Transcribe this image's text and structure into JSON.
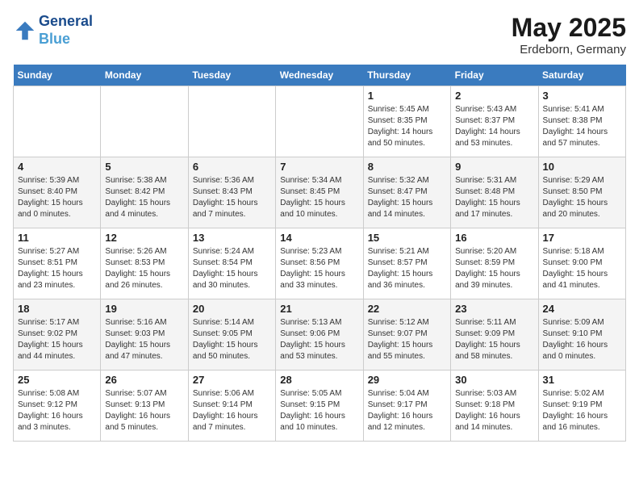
{
  "logo": {
    "line1": "General",
    "line2": "Blue"
  },
  "title": "May 2025",
  "subtitle": "Erdeborn, Germany",
  "weekdays": [
    "Sunday",
    "Monday",
    "Tuesday",
    "Wednesday",
    "Thursday",
    "Friday",
    "Saturday"
  ],
  "weeks": [
    [
      {
        "day": "",
        "info": ""
      },
      {
        "day": "",
        "info": ""
      },
      {
        "day": "",
        "info": ""
      },
      {
        "day": "",
        "info": ""
      },
      {
        "day": "1",
        "info": "Sunrise: 5:45 AM\nSunset: 8:35 PM\nDaylight: 14 hours and 50 minutes."
      },
      {
        "day": "2",
        "info": "Sunrise: 5:43 AM\nSunset: 8:37 PM\nDaylight: 14 hours and 53 minutes."
      },
      {
        "day": "3",
        "info": "Sunrise: 5:41 AM\nSunset: 8:38 PM\nDaylight: 14 hours and 57 minutes."
      }
    ],
    [
      {
        "day": "4",
        "info": "Sunrise: 5:39 AM\nSunset: 8:40 PM\nDaylight: 15 hours and 0 minutes."
      },
      {
        "day": "5",
        "info": "Sunrise: 5:38 AM\nSunset: 8:42 PM\nDaylight: 15 hours and 4 minutes."
      },
      {
        "day": "6",
        "info": "Sunrise: 5:36 AM\nSunset: 8:43 PM\nDaylight: 15 hours and 7 minutes."
      },
      {
        "day": "7",
        "info": "Sunrise: 5:34 AM\nSunset: 8:45 PM\nDaylight: 15 hours and 10 minutes."
      },
      {
        "day": "8",
        "info": "Sunrise: 5:32 AM\nSunset: 8:47 PM\nDaylight: 15 hours and 14 minutes."
      },
      {
        "day": "9",
        "info": "Sunrise: 5:31 AM\nSunset: 8:48 PM\nDaylight: 15 hours and 17 minutes."
      },
      {
        "day": "10",
        "info": "Sunrise: 5:29 AM\nSunset: 8:50 PM\nDaylight: 15 hours and 20 minutes."
      }
    ],
    [
      {
        "day": "11",
        "info": "Sunrise: 5:27 AM\nSunset: 8:51 PM\nDaylight: 15 hours and 23 minutes."
      },
      {
        "day": "12",
        "info": "Sunrise: 5:26 AM\nSunset: 8:53 PM\nDaylight: 15 hours and 26 minutes."
      },
      {
        "day": "13",
        "info": "Sunrise: 5:24 AM\nSunset: 8:54 PM\nDaylight: 15 hours and 30 minutes."
      },
      {
        "day": "14",
        "info": "Sunrise: 5:23 AM\nSunset: 8:56 PM\nDaylight: 15 hours and 33 minutes."
      },
      {
        "day": "15",
        "info": "Sunrise: 5:21 AM\nSunset: 8:57 PM\nDaylight: 15 hours and 36 minutes."
      },
      {
        "day": "16",
        "info": "Sunrise: 5:20 AM\nSunset: 8:59 PM\nDaylight: 15 hours and 39 minutes."
      },
      {
        "day": "17",
        "info": "Sunrise: 5:18 AM\nSunset: 9:00 PM\nDaylight: 15 hours and 41 minutes."
      }
    ],
    [
      {
        "day": "18",
        "info": "Sunrise: 5:17 AM\nSunset: 9:02 PM\nDaylight: 15 hours and 44 minutes."
      },
      {
        "day": "19",
        "info": "Sunrise: 5:16 AM\nSunset: 9:03 PM\nDaylight: 15 hours and 47 minutes."
      },
      {
        "day": "20",
        "info": "Sunrise: 5:14 AM\nSunset: 9:05 PM\nDaylight: 15 hours and 50 minutes."
      },
      {
        "day": "21",
        "info": "Sunrise: 5:13 AM\nSunset: 9:06 PM\nDaylight: 15 hours and 53 minutes."
      },
      {
        "day": "22",
        "info": "Sunrise: 5:12 AM\nSunset: 9:07 PM\nDaylight: 15 hours and 55 minutes."
      },
      {
        "day": "23",
        "info": "Sunrise: 5:11 AM\nSunset: 9:09 PM\nDaylight: 15 hours and 58 minutes."
      },
      {
        "day": "24",
        "info": "Sunrise: 5:09 AM\nSunset: 9:10 PM\nDaylight: 16 hours and 0 minutes."
      }
    ],
    [
      {
        "day": "25",
        "info": "Sunrise: 5:08 AM\nSunset: 9:12 PM\nDaylight: 16 hours and 3 minutes."
      },
      {
        "day": "26",
        "info": "Sunrise: 5:07 AM\nSunset: 9:13 PM\nDaylight: 16 hours and 5 minutes."
      },
      {
        "day": "27",
        "info": "Sunrise: 5:06 AM\nSunset: 9:14 PM\nDaylight: 16 hours and 7 minutes."
      },
      {
        "day": "28",
        "info": "Sunrise: 5:05 AM\nSunset: 9:15 PM\nDaylight: 16 hours and 10 minutes."
      },
      {
        "day": "29",
        "info": "Sunrise: 5:04 AM\nSunset: 9:17 PM\nDaylight: 16 hours and 12 minutes."
      },
      {
        "day": "30",
        "info": "Sunrise: 5:03 AM\nSunset: 9:18 PM\nDaylight: 16 hours and 14 minutes."
      },
      {
        "day": "31",
        "info": "Sunrise: 5:02 AM\nSunset: 9:19 PM\nDaylight: 16 hours and 16 minutes."
      }
    ]
  ]
}
